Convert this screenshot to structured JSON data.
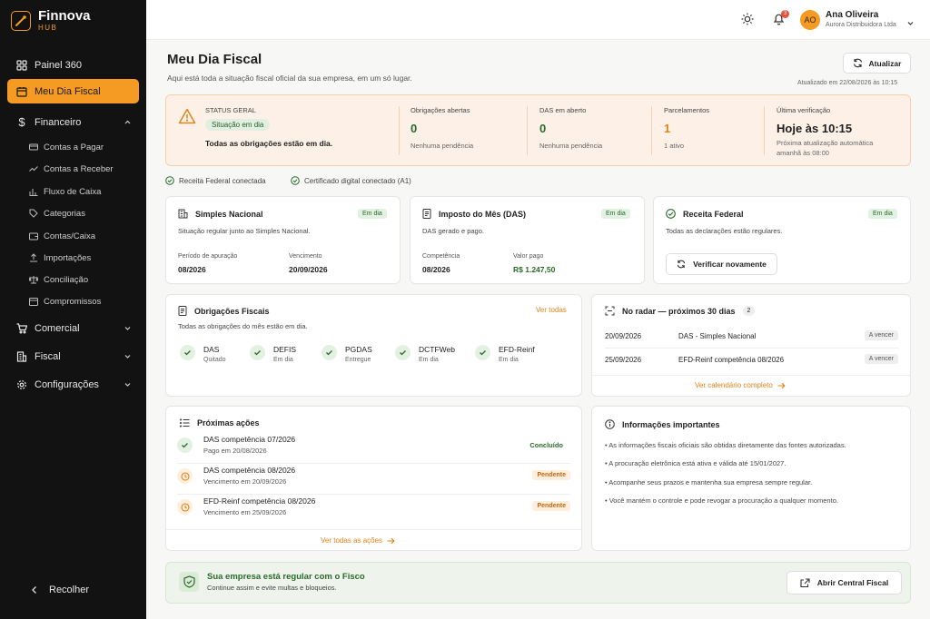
{
  "brand": {
    "name": "Finnova",
    "sub": "HUB"
  },
  "colors": {
    "accent": "#f59a23",
    "success": "#2a6a2a",
    "sidebar_bg": "#121212"
  },
  "sidebar": {
    "items": [
      {
        "label": "Painel 360",
        "icon": "grid-icon"
      },
      {
        "label": "Meu Dia Fiscal",
        "icon": "calendar-icon",
        "active": true
      },
      {
        "label": "Financeiro",
        "icon": "dollar-icon",
        "expanded": true
      },
      {
        "label": "Comercial",
        "icon": "cart-icon"
      },
      {
        "label": "Fiscal",
        "icon": "building-icon"
      },
      {
        "label": "Configurações",
        "icon": "gear-icon"
      }
    ],
    "financeiro_sub": [
      {
        "label": "Contas a Pagar"
      },
      {
        "label": "Contas a Receber"
      },
      {
        "label": "Fluxo de Caixa"
      },
      {
        "label": "Categorias"
      },
      {
        "label": "Contas/Caixa"
      },
      {
        "label": "Importações"
      },
      {
        "label": "Conciliação"
      },
      {
        "label": "Compromissos"
      }
    ],
    "collapse_label": "Recolher"
  },
  "topbar": {
    "notifications_count": "3",
    "user_initials": "AO",
    "user_name": "Ana Oliveira",
    "user_company": "Aurora Distribuidora Ltda"
  },
  "page": {
    "title": "Meu Dia Fiscal",
    "subtitle": "Aqui está toda a situação fiscal oficial da sua empresa, em um só lugar.",
    "refresh_label": "Atualizar",
    "updated_at": "Atualizado em 22/08/2026 às 10:15"
  },
  "status": {
    "label": "STATUS GERAL",
    "pill": "Situação em dia",
    "message": "Todas as obrigações estão em dia.",
    "cols": [
      {
        "label": "Obrigações abertas",
        "value": "0",
        "note": "Nenhuma pendência"
      },
      {
        "label": "DAS em aberto",
        "value": "0",
        "note": "Nenhuma pendência"
      },
      {
        "label": "Parcelamentos",
        "value": "1",
        "note": "1 ativo"
      },
      {
        "label": "Última verificação",
        "value": "Hoje às 10:15",
        "note": "Próxima atualização automática amanhã às 08:00"
      }
    ]
  },
  "connections": [
    "Receita Federal conectada",
    "Certificado digital conectado (A1)"
  ],
  "simples": {
    "title": "Simples Nacional",
    "badge": "Em dia",
    "text": "Situação regular junto ao Simples Nacional.",
    "period_label": "Período de apuração",
    "period_value": "08/2026",
    "due_label": "Vencimento",
    "due_value": "20/09/2026"
  },
  "das": {
    "title": "Imposto do Mês (DAS)",
    "badge": "Em dia",
    "text": "DAS gerado e pago.",
    "comp_label": "Competência",
    "comp_value": "08/2026",
    "paid_label": "Valor pago",
    "paid_value": "R$ 1.247,50"
  },
  "receita": {
    "title": "Receita Federal",
    "badge": "Em dia",
    "text": "Todas as declarações estão regulares.",
    "button": "Verificar novamente"
  },
  "obrigacoes": {
    "title": "Obrigações Fiscais",
    "link": "Ver todas",
    "text": "Todas as obrigações do mês estão em dia.",
    "items": [
      {
        "name": "DAS",
        "status": "Quitado"
      },
      {
        "name": "DEFIS",
        "status": "Em dia"
      },
      {
        "name": "PGDAS",
        "status": "Entregue"
      },
      {
        "name": "DCTFWeb",
        "status": "Em dia"
      },
      {
        "name": "EFD-Reinf",
        "status": "Em dia"
      }
    ]
  },
  "radar": {
    "title": "No radar — próximos 30 dias",
    "count": "2",
    "rows": [
      {
        "date": "20/09/2026",
        "desc": "DAS - Simples Nacional",
        "badge": "A vencer"
      },
      {
        "date": "25/09/2026",
        "desc": "EFD-Reinf competência 08/2026",
        "badge": "A vencer"
      }
    ],
    "link": "Ver calendário completo"
  },
  "acoes": {
    "title": "Próximas ações",
    "rows": [
      {
        "title": "DAS competência 07/2026",
        "sub": "Pago em 20/08/2026",
        "status": "Concluído",
        "state": "done"
      },
      {
        "title": "DAS competência 08/2026",
        "sub": "Vencimento em 20/09/2026",
        "status": "Pendente",
        "state": "pending"
      },
      {
        "title": "EFD-Reinf competência 08/2026",
        "sub": "Vencimento em 25/09/2026",
        "status": "Pendente",
        "state": "pending"
      }
    ],
    "link": "Ver todas as ações"
  },
  "info": {
    "title": "Informações importantes",
    "bullets": [
      "• As informações fiscais oficiais são obtidas diretamente das fontes autorizadas.",
      "• A procuração eletrônica está ativa e válida até 15/01/2027.",
      "• Acompanhe seus prazos e mantenha sua empresa sempre regular.",
      "• Você mantém o controle e pode revogar a procuração a qualquer momento."
    ]
  },
  "regular": {
    "title": "Sua empresa está regular com o Fisco",
    "sub": "Continue assim e evite multas e bloqueios.",
    "button": "Abrir Central Fiscal"
  }
}
